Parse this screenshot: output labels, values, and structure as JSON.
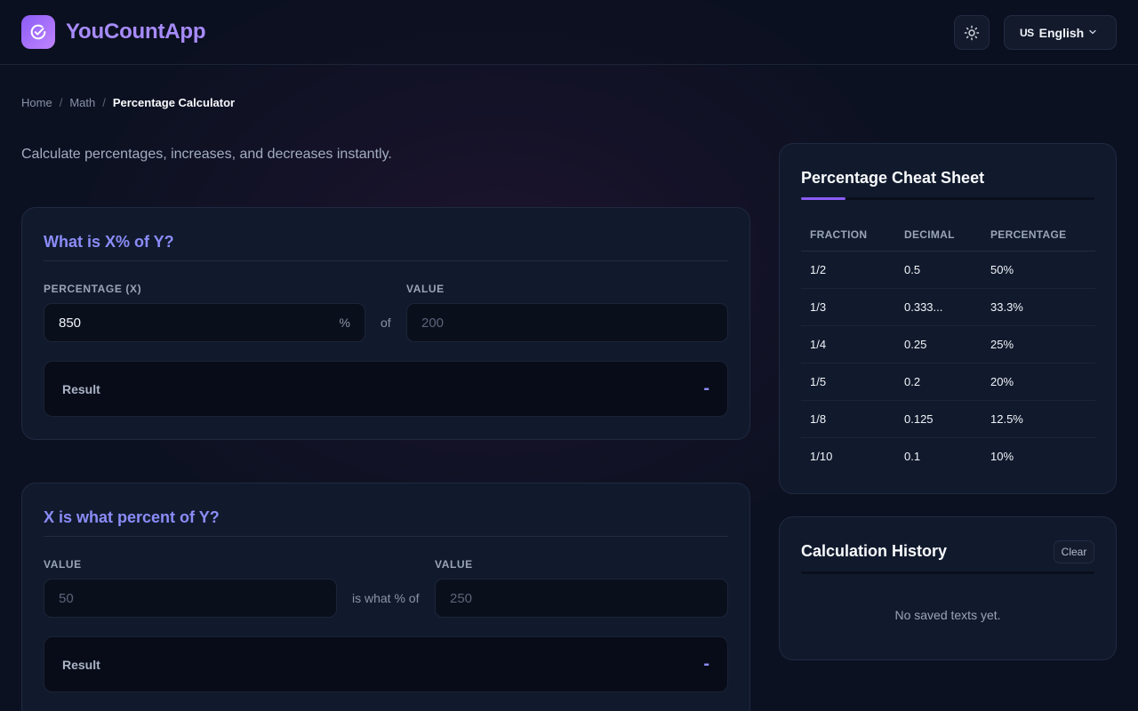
{
  "header": {
    "brand": "YouCountApp",
    "language": {
      "flag": "US",
      "label": "English"
    }
  },
  "breadcrumb": {
    "items": [
      "Home",
      "Math"
    ],
    "current": "Percentage Calculator",
    "separator": "/"
  },
  "subtitle": "Calculate percentages, increases, and decreases instantly.",
  "calc1": {
    "title": "What is X% of Y?",
    "percentage_label": "PERCENTAGE (X)",
    "percentage_value": "850",
    "percentage_suffix": "%",
    "connector": "of",
    "value_label": "VALUE",
    "value_placeholder": "200",
    "result_label": "Result",
    "result_value": "-"
  },
  "calc2": {
    "title": "X is what percent of Y?",
    "value1_label": "VALUE",
    "value1_placeholder": "50",
    "connector": "is what % of",
    "value2_label": "VALUE",
    "value2_placeholder": "250",
    "result_label": "Result",
    "result_value": "-"
  },
  "cheat_sheet": {
    "title": "Percentage Cheat Sheet",
    "columns": [
      "FRACTION",
      "DECIMAL",
      "PERCENTAGE"
    ],
    "rows": [
      [
        "1/2",
        "0.5",
        "50%"
      ],
      [
        "1/3",
        "0.333...",
        "33.3%"
      ],
      [
        "1/4",
        "0.25",
        "25%"
      ],
      [
        "1/5",
        "0.2",
        "20%"
      ],
      [
        "1/8",
        "0.125",
        "12.5%"
      ],
      [
        "1/10",
        "0.1",
        "10%"
      ]
    ]
  },
  "history": {
    "title": "Calculation History",
    "clear_label": "Clear",
    "empty_text": "No saved texts yet."
  },
  "colors": {
    "accent": "#8b5cf6",
    "title_accent": "#8b8cf7",
    "background": "#0c1121",
    "card": "#111a2d"
  },
  "icons": {
    "logo": "check-badge-icon",
    "theme": "sun-icon",
    "language_dropdown": "chevron-down-icon"
  }
}
